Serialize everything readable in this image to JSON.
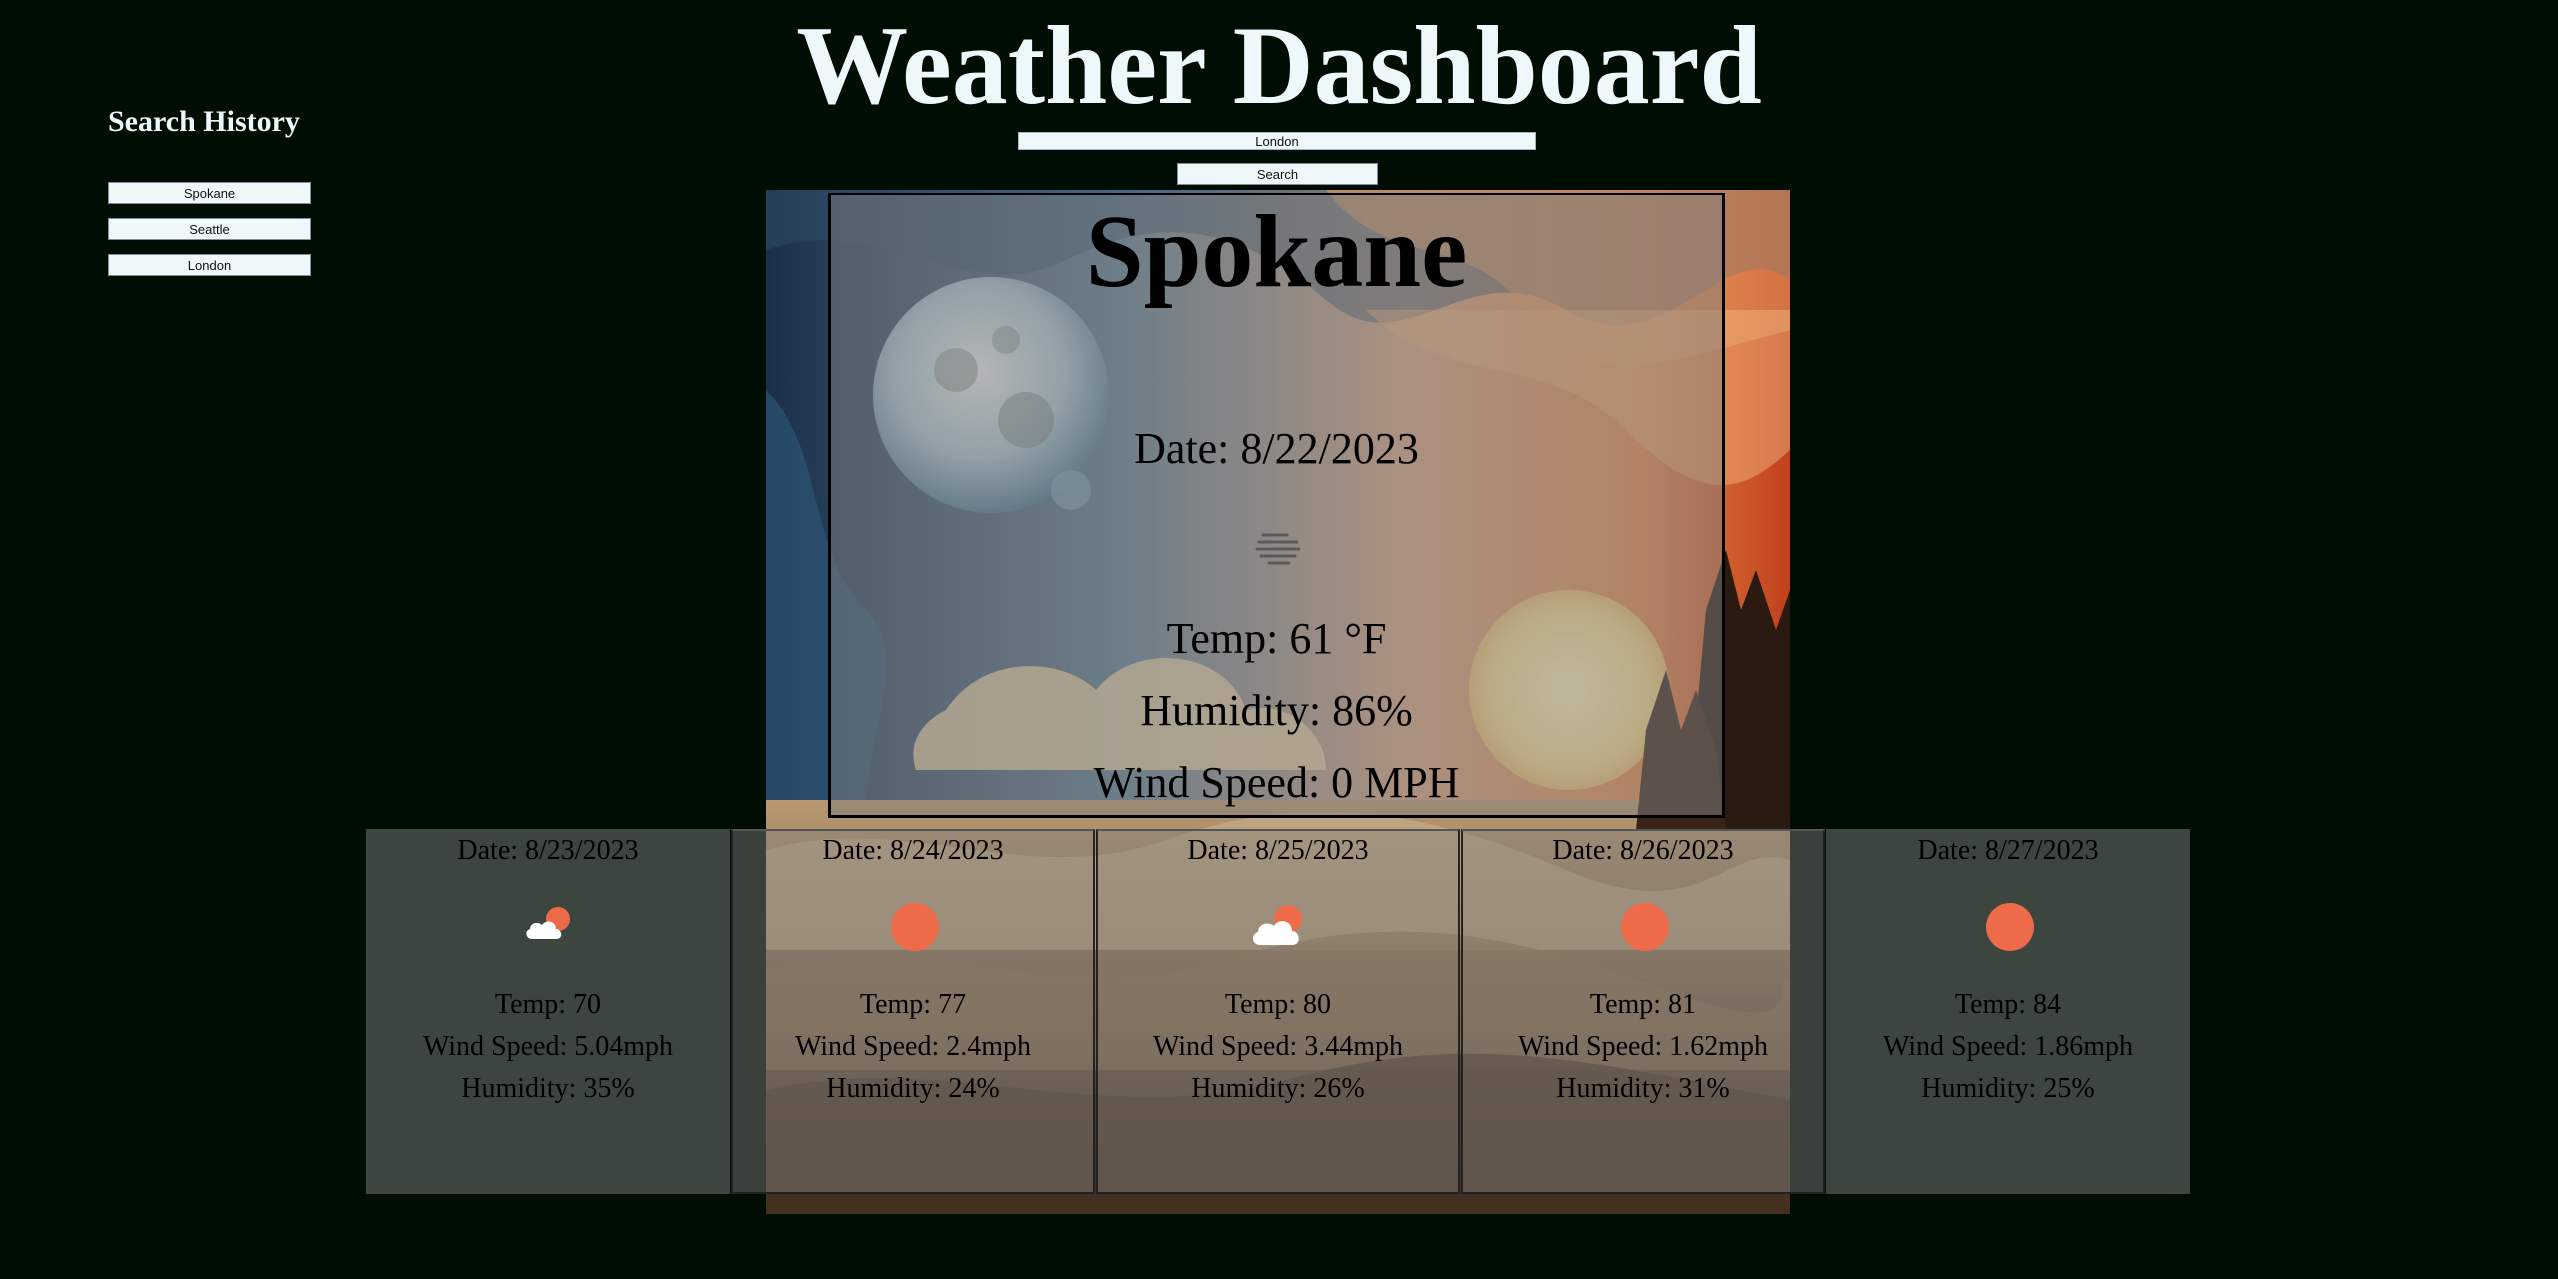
{
  "header": {
    "title": "Weather Dashboard"
  },
  "search": {
    "value": "London",
    "button_label": "Search"
  },
  "history": {
    "title": "Search History",
    "items": [
      {
        "label": "Spokane"
      },
      {
        "label": "Seattle"
      },
      {
        "label": "London"
      }
    ]
  },
  "current": {
    "city": "Spokane",
    "date": "Date: 8/22/2023",
    "icon": "mist-icon",
    "temp": "Temp: 61 °F",
    "humidity": "Humidity: 86%",
    "wind": "Wind Speed: 0 MPH"
  },
  "forecast": [
    {
      "date": "Date: 8/23/2023",
      "icon": "partly-cloudy-icon",
      "temp": "Temp: 70",
      "wind": "Wind Speed: 5.04mph",
      "humidity": "Humidity: 35%"
    },
    {
      "date": "Date: 8/24/2023",
      "icon": "sun-icon",
      "temp": "Temp: 77",
      "wind": "Wind Speed: 2.4mph",
      "humidity": "Humidity: 24%"
    },
    {
      "date": "Date: 8/25/2023",
      "icon": "partly-cloudy-icon",
      "temp": "Temp: 80",
      "wind": "Wind Speed: 3.44mph",
      "humidity": "Humidity: 26%"
    },
    {
      "date": "Date: 8/26/2023",
      "icon": "sun-icon",
      "temp": "Temp: 81",
      "wind": "Wind Speed: 1.62mph",
      "humidity": "Humidity: 31%"
    },
    {
      "date": "Date: 8/27/2023",
      "icon": "sun-icon",
      "temp": "Temp: 84",
      "wind": "Wind Speed: 1.86mph",
      "humidity": "Humidity: 25%"
    }
  ],
  "colors": {
    "background": "#000d03",
    "heading": "#eef8fb",
    "sun": "#ee6b4a",
    "card_overlay": "rgba(125,125,125,0.5)",
    "card_solid": "#3d453f"
  }
}
